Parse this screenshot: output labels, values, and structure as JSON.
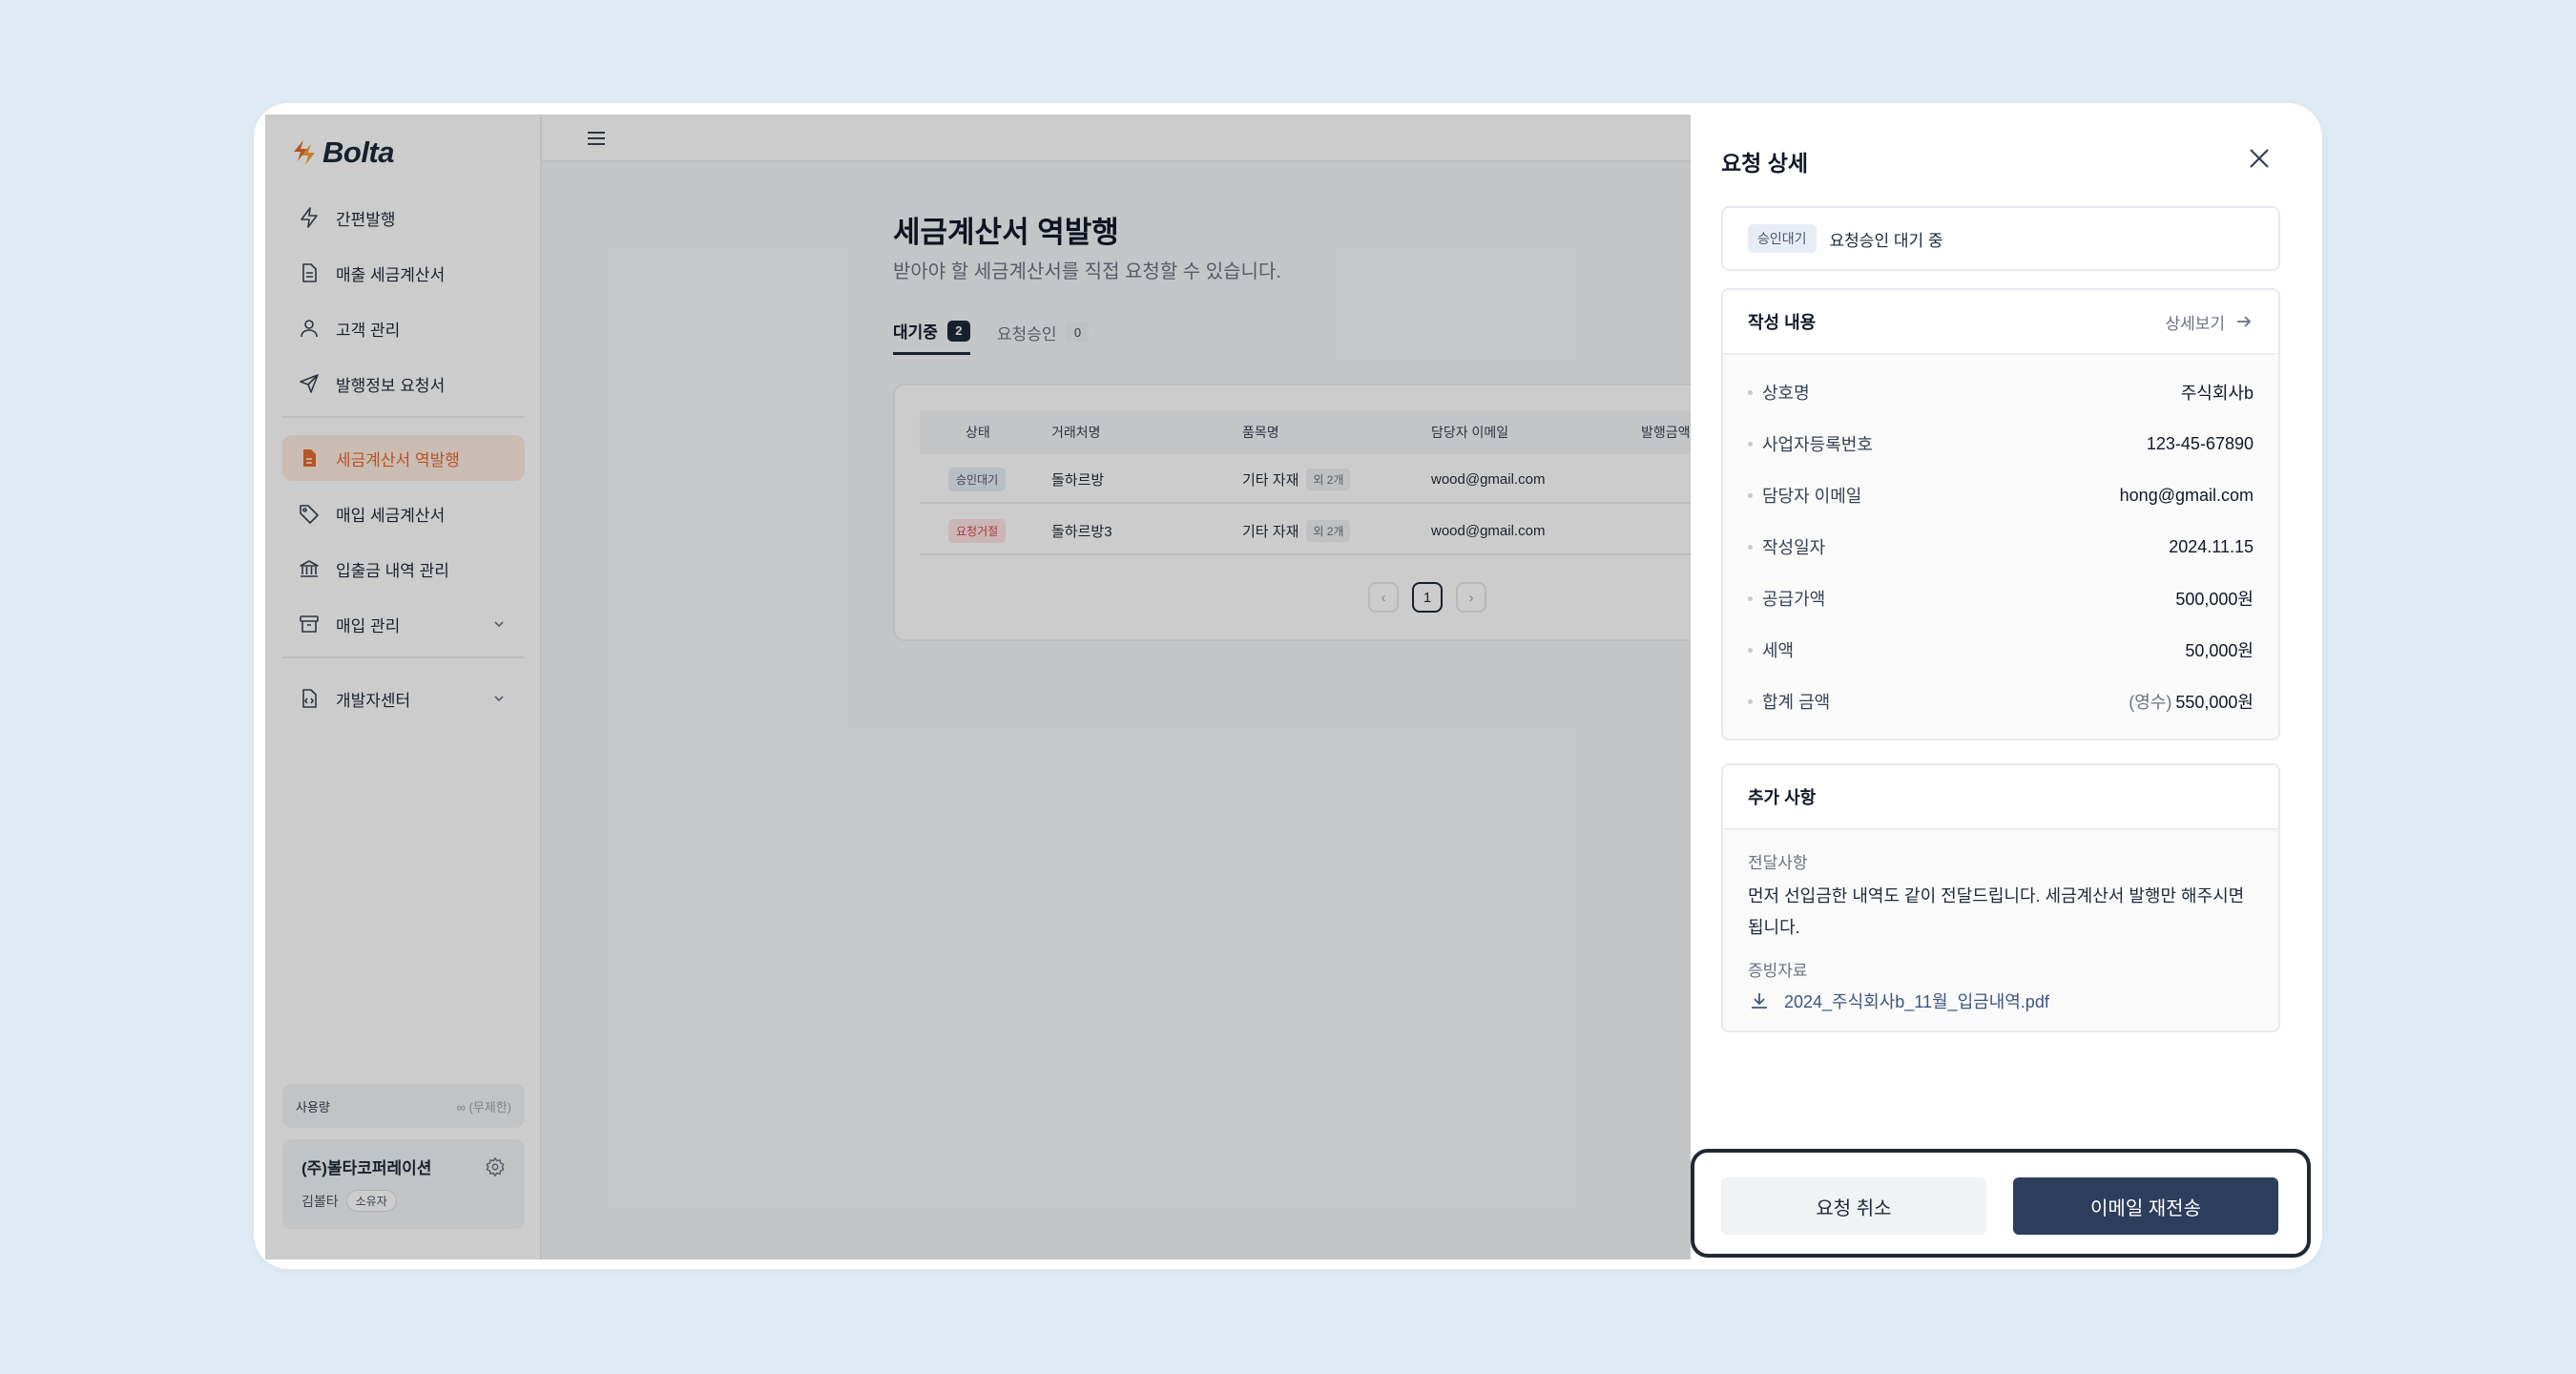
{
  "brand": {
    "name": "Bolta",
    "accent": "#e46a2b"
  },
  "sidebar": {
    "items": [
      {
        "label": "간편발행",
        "icon": "lightning-icon"
      },
      {
        "label": "매출 세금계산서",
        "icon": "document-icon"
      },
      {
        "label": "고객 관리",
        "icon": "person-icon"
      },
      {
        "label": "발행정보 요청서",
        "icon": "send-icon"
      },
      {
        "label": "세금계산서 역발행",
        "icon": "reverse-invoice-icon",
        "active": true
      },
      {
        "label": "매입 세금계산서",
        "icon": "tag-icon"
      },
      {
        "label": "입출금 내역 관리",
        "icon": "bank-icon"
      },
      {
        "label": "매입 관리",
        "icon": "archive-icon",
        "expandable": true
      },
      {
        "label": "개발자센터",
        "icon": "code-file-icon",
        "expandable": true
      }
    ],
    "usage": {
      "label": "사용량",
      "value": "∞ (무제한)"
    },
    "company": {
      "name": "(주)볼타코퍼레이션",
      "user": "김볼타",
      "role": "소유자"
    }
  },
  "main": {
    "title": "세금계산서 역발행",
    "subtitle": "받아야 할 세금계산서를 직접 요청할 수 있습니다.",
    "tabs": [
      {
        "label": "대기중",
        "count": "2"
      },
      {
        "label": "요청승인",
        "count": "0"
      }
    ],
    "table": {
      "headers": [
        "상태",
        "거래처명",
        "품목명",
        "담당자 이메일",
        "발행금액"
      ],
      "rows": [
        {
          "status": "승인대기",
          "partner": "돌하르방",
          "item": "기타 자재",
          "more": "외 2개",
          "email": "wood@gmail.com"
        },
        {
          "status": "요청거절",
          "partner": "돌하르방3",
          "item": "기타 자재",
          "more": "외 2개",
          "email": "wood@gmail.com"
        }
      ],
      "pager": {
        "prev": "‹",
        "current": "1",
        "next": "›"
      }
    }
  },
  "drawer": {
    "title": "요청 상세",
    "status": {
      "badge": "승인대기",
      "text": "요청승인 대기 중"
    },
    "content": {
      "title": "작성 내용",
      "detail_link": "상세보기",
      "fields": [
        {
          "label": "상호명",
          "value": "주식회사b"
        },
        {
          "label": "사업자등록번호",
          "value": "123-45-67890"
        },
        {
          "label": "담당자 이메일",
          "value": "hong@gmail.com"
        },
        {
          "label": "작성일자",
          "value": "2024.11.15"
        },
        {
          "label": "공급가액",
          "value": "500,000원"
        },
        {
          "label": "세액",
          "value": "50,000원"
        },
        {
          "label": "합계 금액",
          "prefix": "(영수)",
          "value": "550,000원"
        }
      ]
    },
    "extra": {
      "title": "추가 사항",
      "message_label": "전달사항",
      "message": "먼저 선입금한 내역도 같이 전달드립니다. 세금계산서 발행만 해주시면 됩니다.",
      "attachment_label": "증빙자료",
      "attachment": "2024_주식회사b_11월_입금내역.pdf"
    },
    "actions": {
      "cancel": "요청 취소",
      "resend": "이메일 재전송"
    }
  }
}
